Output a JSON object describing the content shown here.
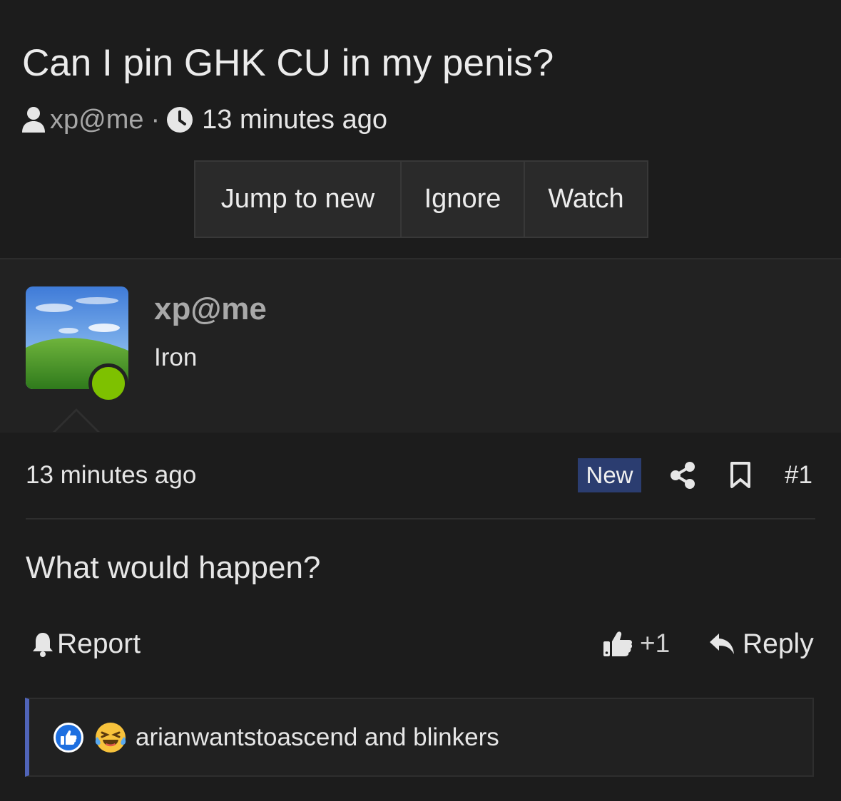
{
  "thread": {
    "title": "Can I pin GHK CU in my penis?",
    "author": "xp@me",
    "separator": "·",
    "time": "13 minutes ago"
  },
  "actions": {
    "jump_to_new": "Jump to new",
    "ignore": "Ignore",
    "watch": "Watch"
  },
  "user": {
    "name": "xp@me",
    "title": "Iron",
    "online": true,
    "online_color": "#7ec100"
  },
  "post": {
    "time": "13 minutes ago",
    "badge": "New",
    "badge_color": "#2b3d70",
    "number": "#1",
    "body": "What would happen?",
    "report_label": "Report",
    "reaction_count": "+1",
    "reply_label": "Reply",
    "share_icon": "share-icon",
    "bookmark_icon": "bookmark-icon"
  },
  "reactions": {
    "icons": [
      "like-icon",
      "laugh-cry-icon"
    ],
    "users": "arianwantstoascend and blinkers",
    "accent_color": "#5064b8"
  }
}
